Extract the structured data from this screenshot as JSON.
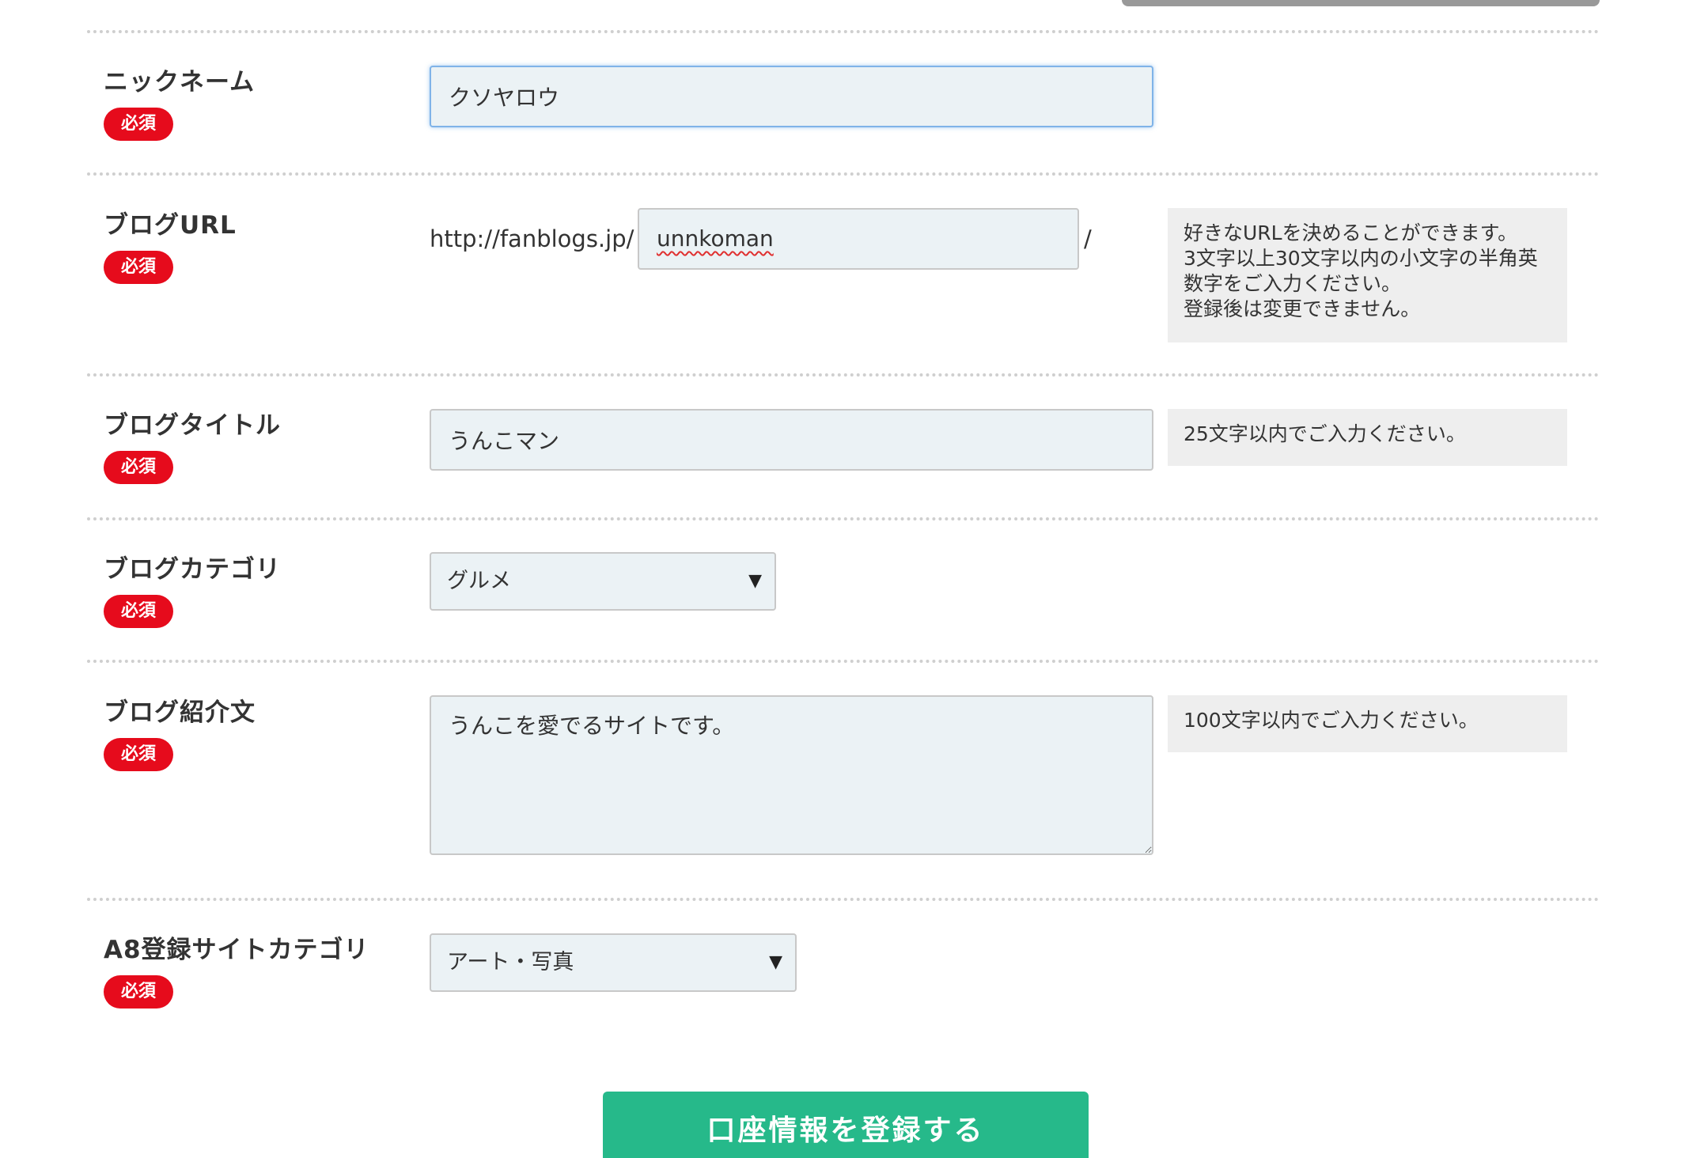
{
  "required_badge": "必須",
  "nickname": {
    "label": "ニックネーム",
    "value": "クソヤロウ"
  },
  "blog_url": {
    "label": "ブログURL",
    "prefix": "http://fanblogs.jp/",
    "value": "unnkoman",
    "suffix": "/",
    "help": "好きなURLを決めることができます。\n3文字以上30文字以内の小文字の半角英\n数字をご入力ください。\n登録後は変更できません。"
  },
  "blog_title": {
    "label": "ブログタイトル",
    "value": "うんこマン",
    "help": "25文字以内でご入力ください。"
  },
  "blog_category": {
    "label": "ブログカテゴリ",
    "selected": "グルメ"
  },
  "blog_intro": {
    "label": "ブログ紹介文",
    "value": "うんこを愛でるサイトです。",
    "help": "100文字以内でご入力ください。"
  },
  "a8_category": {
    "label": "A8登録サイトカテゴリ",
    "selected": "アート・写真"
  },
  "submit_label": "口座情報を登録する",
  "colors": {
    "required_badge": "#e60b1c",
    "submit_button": "#26b98a",
    "field_bg": "#ebf2f5",
    "help_bg": "#eeeeee"
  }
}
